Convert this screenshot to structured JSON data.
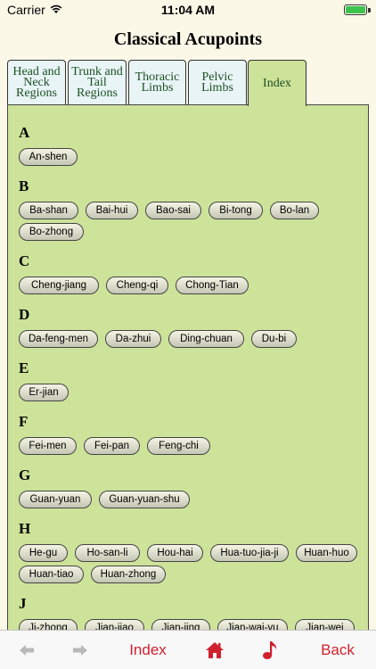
{
  "status_bar": {
    "carrier": "Carrier",
    "time": "11:04 AM"
  },
  "page": {
    "title": "Classical Acupoints"
  },
  "tabs": [
    {
      "label": "Head and\nNeck\nRegions"
    },
    {
      "label": "Trunk and\nTail\nRegions"
    },
    {
      "label": "Thoracic\nLimbs"
    },
    {
      "label": "Pelvic\nLimbs"
    },
    {
      "label": "Index"
    }
  ],
  "index": [
    {
      "letter": "A",
      "items": [
        "An-shen"
      ]
    },
    {
      "letter": "B",
      "items": [
        "Ba-shan",
        "Bai-hui",
        "Bao-sai",
        "Bi-tong",
        "Bo-lan",
        "Bo-zhong"
      ]
    },
    {
      "letter": "C",
      "items": [
        "Cheng-jiang",
        "Cheng-qi",
        "Chong-Tian"
      ]
    },
    {
      "letter": "D",
      "items": [
        "Da-feng-men",
        "Da-zhui",
        "Ding-chuan",
        "Du-bi"
      ]
    },
    {
      "letter": "E",
      "items": [
        "Er-jian"
      ]
    },
    {
      "letter": "F",
      "items": [
        "Fei-men",
        "Fei-pan",
        "Feng-chi"
      ]
    },
    {
      "letter": "G",
      "items": [
        "Guan-yuan",
        "Guan-yuan-shu"
      ]
    },
    {
      "letter": "H",
      "items": [
        "He-gu",
        "Ho-san-li",
        "Hou-hai",
        "Hua-tuo-jia-ji",
        "Huan-huo",
        "Huan-tiao",
        "Huan-zhong"
      ]
    },
    {
      "letter": "J",
      "items": [
        "Ji-zhong",
        "Jian-jiao",
        "Jian-jing",
        "Jian-wai-yu",
        "Jian-wei"
      ]
    }
  ],
  "toolbar": {
    "index_label": "Index",
    "back_label": "Back",
    "icons": [
      "arrow-left-icon",
      "arrow-right-icon",
      "home-icon",
      "music-note-icon"
    ],
    "accent": "#d0202e",
    "disabled": "#b8b8b8"
  },
  "colors": {
    "content_bg": "#cde39a",
    "tab_bg": "#e8f4f6",
    "page_bg": "#fbf8e8"
  }
}
